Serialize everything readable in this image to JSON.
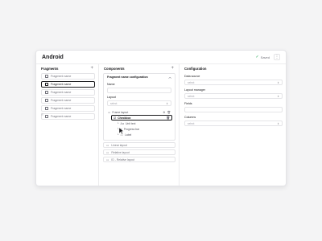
{
  "app": {
    "title": "Android",
    "saved_label": "Saved"
  },
  "fragments": {
    "header": "Fragments",
    "items": [
      {
        "label": "Fragment name",
        "selected": false
      },
      {
        "label": "Fragment name",
        "selected": true
      },
      {
        "label": "Fragment name",
        "selected": false
      },
      {
        "label": "Fragment name",
        "selected": false
      },
      {
        "label": "Fragment name",
        "selected": false
      },
      {
        "label": "Fragment name",
        "selected": false
      }
    ]
  },
  "components": {
    "header": "Components",
    "card_title": "Fragment name configuration",
    "name_label": "Name",
    "layout_label": "Layout",
    "layout_placeholder": "select",
    "tree": {
      "frame_layout": "Frame layout",
      "checkbox": "Checkbox",
      "text": "Unit text",
      "progress": "Progress bar",
      "label": "Label"
    },
    "bottom_items": [
      "Linear layout",
      "Relative layout",
      "ID - Relative layout"
    ]
  },
  "configuration": {
    "header": "Configuration",
    "fields": [
      {
        "label": "Data source",
        "placeholder": "select",
        "type": "select"
      },
      {
        "label": "Layout manager",
        "placeholder": "select",
        "type": "select"
      },
      {
        "label": "Fields",
        "placeholder": "",
        "type": "input"
      },
      {
        "label": "Columns",
        "placeholder": "select",
        "type": "select"
      }
    ]
  }
}
